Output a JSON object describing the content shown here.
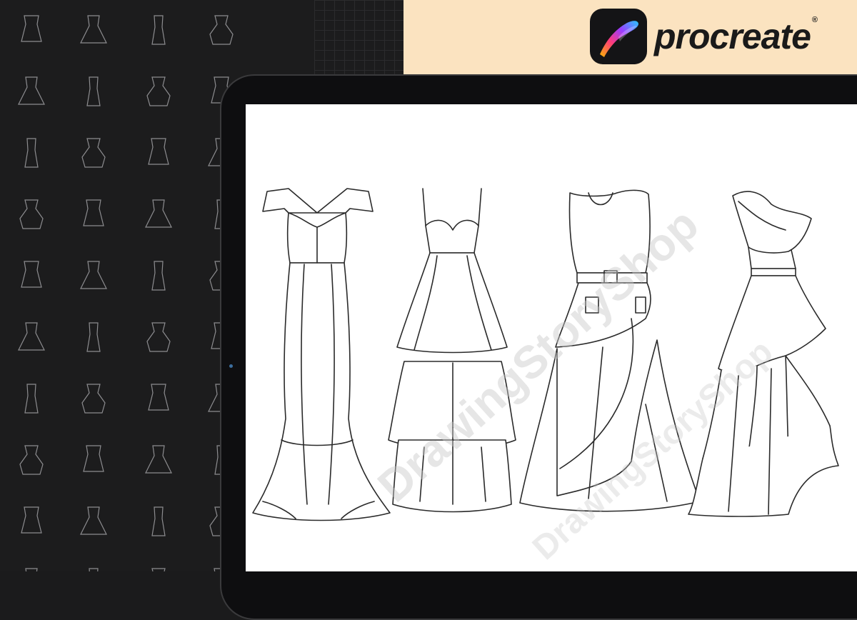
{
  "brand": {
    "name": "procreate",
    "registered_mark": "®",
    "banner_color": "#fbe3c0"
  },
  "canvas": {
    "watermark_text": "DrawingStoryShop",
    "background": "#ffffff",
    "sketch_stroke": "#2a2a2a"
  },
  "thumbnails": {
    "columns": 4,
    "rows": 10,
    "stroke": "#8d8d90",
    "icon": "dress-sketch-icon"
  },
  "dresses": [
    {
      "name": "off-shoulder-mermaid-gown"
    },
    {
      "name": "spaghetti-strap-tiered-peplum-gown"
    },
    {
      "name": "sleeveless-belted-asymmetric-gown"
    },
    {
      "name": "one-shoulder-ruffle-gown"
    }
  ]
}
